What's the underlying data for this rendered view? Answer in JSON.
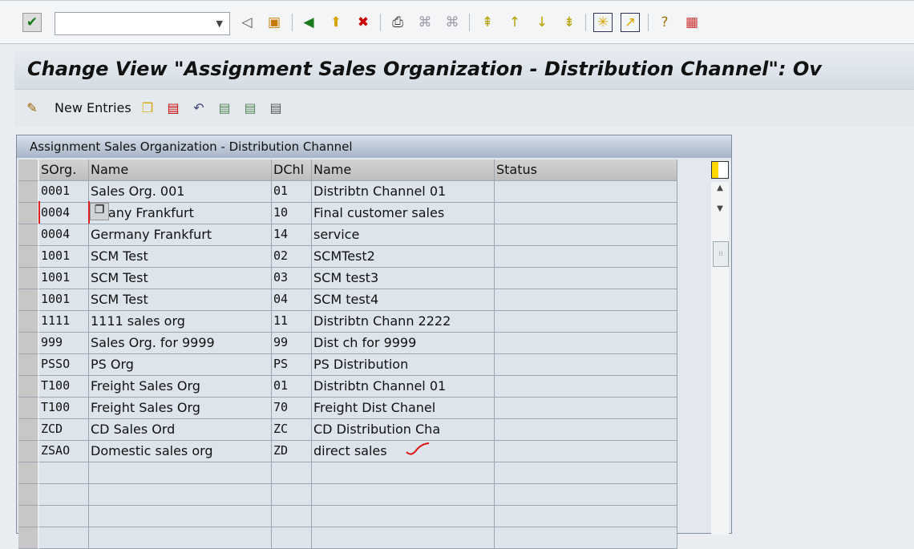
{
  "toolbar": {
    "command_field": "",
    "icons": [
      "enter-icon",
      "back-icon",
      "save-icon",
      "back-green-icon",
      "exit-icon",
      "cancel-icon",
      "print-icon",
      "find-icon",
      "find-next-icon",
      "first-page-icon",
      "previous-page-icon",
      "next-page-icon",
      "last-page-icon",
      "create-session-icon",
      "shortcut-icon",
      "help-icon",
      "customize-layout-icon"
    ]
  },
  "title": "Change View \"Assignment Sales Organization - Distribution Channel\": Ov",
  "app_toolbar": {
    "new_entries": "New Entries"
  },
  "table": {
    "title": "Assignment Sales Organization - Distribution Channel",
    "headers": [
      "SOrg.",
      "Name",
      "DChl",
      "Name",
      "Status"
    ],
    "rows": [
      [
        "0001",
        "Sales Org. 001",
        "01",
        "Distribtn Channel 01",
        ""
      ],
      [
        "0004",
        "rmany Frankfurt",
        "10",
        "Final customer sales",
        ""
      ],
      [
        "0004",
        "Germany Frankfurt",
        "14",
        "service",
        ""
      ],
      [
        "1001",
        "SCM Test",
        "02",
        "SCMTest2",
        ""
      ],
      [
        "1001",
        "SCM Test",
        "03",
        "SCM test3",
        ""
      ],
      [
        "1001",
        "SCM Test",
        "04",
        "SCM test4",
        ""
      ],
      [
        "1111",
        "1111 sales org",
        "11",
        "Distribtn Chann 2222",
        ""
      ],
      [
        "999",
        "Sales Org. for 9999",
        "99",
        "Dist ch for 9999",
        ""
      ],
      [
        "PSSO",
        "PS Org",
        "PS",
        "PS Distribution",
        ""
      ],
      [
        "T100",
        "Freight Sales Org",
        "01",
        "Distribtn Channel 01",
        ""
      ],
      [
        "T100",
        "Freight Sales Org",
        "70",
        "Freight Dist Chanel",
        ""
      ],
      [
        "ZCD",
        "CD Sales Ord",
        "ZC",
        "CD  Distribution Cha",
        ""
      ],
      [
        "ZSAO",
        "Domestic sales org",
        "ZD",
        "direct sales",
        ""
      ]
    ],
    "empty_rows": 4
  }
}
